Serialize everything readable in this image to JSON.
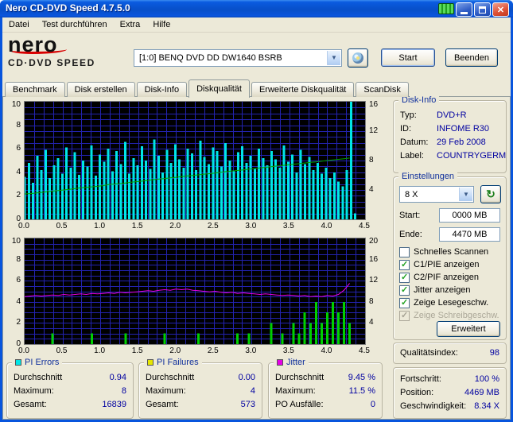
{
  "window": {
    "title": "Nero CD-DVD Speed 4.7.5.0"
  },
  "menu": {
    "items": [
      {
        "label": "Datei"
      },
      {
        "label": "Test durchführen"
      },
      {
        "label": "Extra"
      },
      {
        "label": "Hilfe"
      }
    ]
  },
  "header": {
    "logo_top": "nero",
    "logo_bottom": "CD·DVD SPEED",
    "drive_selector": "[1:0]  BENQ DVD DD DW1640 BSRB",
    "start_button": "Start",
    "exit_button": "Beenden"
  },
  "tabs": [
    {
      "label": "Benchmark",
      "selected": false
    },
    {
      "label": "Disk erstellen",
      "selected": false
    },
    {
      "label": "Disk-Info",
      "selected": false
    },
    {
      "label": "Diskqualität",
      "selected": true
    },
    {
      "label": "Erweiterte Diskqualität",
      "selected": false
    },
    {
      "label": "ScanDisk",
      "selected": false
    }
  ],
  "disk_info": {
    "title": "Disk-Info",
    "typ_label": "Typ:",
    "typ_value": "DVD+R",
    "id_label": "ID:",
    "id_value": "INFOME R30",
    "datum_label": "Datum:",
    "datum_value": "29 Feb 2008",
    "label_label": "Label:",
    "label_value": "COUNTRYGERM"
  },
  "settings": {
    "title": "Einstellungen",
    "speed_value": "8 X",
    "start_label": "Start:",
    "start_value": "0000 MB",
    "ende_label": "Ende:",
    "ende_value": "4470 MB",
    "checkboxes": [
      {
        "label": "Schnelles Scannen",
        "checked": false,
        "disabled": false
      },
      {
        "label": "C1/PIE anzeigen",
        "checked": true,
        "disabled": false
      },
      {
        "label": "C2/PIF anzeigen",
        "checked": true,
        "disabled": false
      },
      {
        "label": "Jitter anzeigen",
        "checked": true,
        "disabled": false
      },
      {
        "label": "Zeige Lesegeschw.",
        "checked": true,
        "disabled": false
      },
      {
        "label": "Zeige Schreibgeschw.",
        "checked": true,
        "disabled": true
      }
    ],
    "erweitert_button": "Erweitert"
  },
  "quality": {
    "label": "Qualitätsindex:",
    "value": "98"
  },
  "stats": {
    "pi_errors": {
      "title": "PI Errors",
      "color": "#00E6E6",
      "rows": [
        [
          "Durchschnitt",
          "0.94"
        ],
        [
          "Maximum:",
          "8"
        ],
        [
          "Gesamt:",
          "16839"
        ]
      ]
    },
    "pi_failures": {
      "title": "PI Failures",
      "color": "#E6E600",
      "rows": [
        [
          "Durchschnitt",
          "0.00"
        ],
        [
          "Maximum:",
          "4"
        ],
        [
          "Gesamt:",
          "573"
        ]
      ]
    },
    "jitter": {
      "title": "Jitter",
      "color": "#E600E6",
      "rows": [
        [
          "Durchschnitt",
          "9.45 %"
        ],
        [
          "Maximum:",
          "11.5 %"
        ],
        [
          "PO Ausfälle:",
          "0"
        ]
      ]
    },
    "progress": {
      "rows": [
        [
          "Fortschritt:",
          "100 %"
        ],
        [
          "Position:",
          "4469 MB"
        ],
        [
          "Geschwindigkeit:",
          "8.34 X"
        ]
      ]
    }
  },
  "chart_data": [
    {
      "type": "bar",
      "x_axis": {
        "min": 0,
        "max": 4.5,
        "grid": 0.125,
        "unit": "GB",
        "ticks": [
          "0.0",
          "0.5",
          "1.0",
          "1.5",
          "2.0",
          "2.5",
          "3.0",
          "3.5",
          "4.0",
          "4.5"
        ]
      },
      "left_axis": {
        "min": 0,
        "max": 10,
        "grid": 0.5,
        "ticks": [
          "10",
          "8",
          "6",
          "4",
          "2",
          "0"
        ]
      },
      "right_axis": {
        "min": 0,
        "max": 16,
        "ticks": [
          "16",
          "12",
          "8",
          "4"
        ]
      },
      "grid_color": "#2323B0",
      "series": [
        {
          "name": "PI Errors (C1/PIE)",
          "style": "bars",
          "axis": "left",
          "color": "#00E6E6",
          "x_span": 4.37,
          "values": [
            3.6,
            4.8,
            3.1,
            5.4,
            4.2,
            5.9,
            3.5,
            4.6,
            5.2,
            3.9,
            6.1,
            4.4,
            5.7,
            3.8,
            5.0,
            4.5,
            6.3,
            3.7,
            5.5,
            4.9,
            6.0,
            4.1,
            5.8,
            4.7,
            6.6,
            3.9,
            5.2,
            4.6,
            6.2,
            5.0,
            4.3,
            6.8,
            5.4,
            4.0,
            5.9,
            4.8,
            6.4,
            5.1,
            4.4,
            6.0,
            5.6,
            4.2,
            6.7,
            5.3,
            4.7,
            6.1,
            5.8,
            4.5,
            6.5,
            5.0,
            4.1,
            5.7,
            6.2,
            4.8,
            5.4,
            4.3,
            6.0,
            5.2,
            4.6,
            5.8,
            5.1,
            4.4,
            6.3,
            4.9,
            5.5,
            4.0,
            5.9,
            4.7,
            5.3,
            4.2,
            4.8,
            3.9,
            4.4,
            3.5,
            4.0,
            3.2,
            2.8,
            4.2,
            10,
            0.5
          ]
        },
        {
          "name": "Lesegeschwindigkeit (X)",
          "style": "line",
          "axis": "right",
          "color": "#00A000",
          "x_span": 4.37,
          "values": [
            3.46,
            3.5,
            3.58,
            3.66,
            3.75,
            3.85,
            3.92,
            4.0,
            4.08,
            4.18,
            4.3,
            4.35,
            4.42,
            4.5,
            4.6,
            4.72,
            4.8,
            4.85,
            4.95,
            5.05,
            5.14,
            5.2,
            5.3,
            5.4,
            5.48,
            5.56,
            5.65,
            5.72,
            5.8,
            5.9,
            5.98,
            6.05,
            6.15,
            6.22,
            6.3,
            6.4,
            6.5,
            6.58,
            6.65,
            6.72,
            6.82,
            6.9,
            7.0,
            7.08,
            7.16,
            7.25,
            7.32,
            7.4,
            7.5,
            7.58,
            7.67,
            7.75,
            7.82,
            7.9,
            8.0,
            8.09,
            8.16,
            8.25,
            8.34,
            null
          ]
        }
      ]
    },
    {
      "type": "line",
      "x_axis": {
        "min": 0,
        "max": 4.5,
        "grid": 0.125,
        "unit": "GB",
        "ticks": [
          "0.0",
          "0.5",
          "1.0",
          "1.5",
          "2.0",
          "2.5",
          "3.0",
          "3.5",
          "4.0",
          "4.5"
        ]
      },
      "left_axis": {
        "min": 0,
        "max": 10,
        "grid": 0.5,
        "ticks": [
          "10",
          "8",
          "6",
          "4",
          "2",
          "0"
        ]
      },
      "right_axis": {
        "min": 0,
        "max": 20,
        "ticks": [
          "20",
          "16",
          "12",
          "8",
          "4"
        ]
      },
      "grid_color": "#2323B0",
      "series": [
        {
          "name": "PI Failures (C2/PIF)",
          "style": "bars",
          "axis": "left",
          "color": "#00D000",
          "x_span": 4.37,
          "values": [
            0,
            0,
            0,
            0,
            0,
            1,
            0,
            0,
            0,
            0,
            0,
            0,
            1,
            0,
            0,
            0,
            0,
            0,
            1,
            0,
            0,
            0,
            0,
            0,
            0,
            1,
            0,
            0,
            0,
            0,
            0,
            1,
            0,
            0,
            0,
            0,
            0,
            0,
            1,
            0,
            1,
            0,
            0,
            0,
            2,
            0,
            1,
            0,
            2,
            1,
            3,
            2,
            4,
            2,
            3,
            4,
            3,
            4,
            2,
            0
          ]
        },
        {
          "name": "Jitter (%)",
          "style": "line",
          "axis": "right",
          "color": "#E600E6",
          "x_span": 4.37,
          "values": [
            9.0,
            9.1,
            9.2,
            9.1,
            9.2,
            9.3,
            9.2,
            9.4,
            9.3,
            9.4,
            9.5,
            9.4,
            9.6,
            9.5,
            9.6,
            9.7,
            9.6,
            9.8,
            9.7,
            9.8,
            9.9,
            10.0,
            10.1,
            10.0,
            10.2,
            10.3,
            10.2,
            10.4,
            10.3,
            10.4,
            10.2,
            10.1,
            10.0,
            9.9,
            10.0,
            9.8,
            9.7,
            9.8,
            9.6,
            9.7,
            9.6,
            9.5,
            9.4,
            9.5,
            9.4,
            9.3,
            9.2,
            9.3,
            9.2,
            9.1,
            9.2,
            9.0,
            9.1,
            9.0,
            9.2,
            9.1,
            9.4,
            10.2,
            11.5,
            null
          ]
        }
      ]
    }
  ]
}
